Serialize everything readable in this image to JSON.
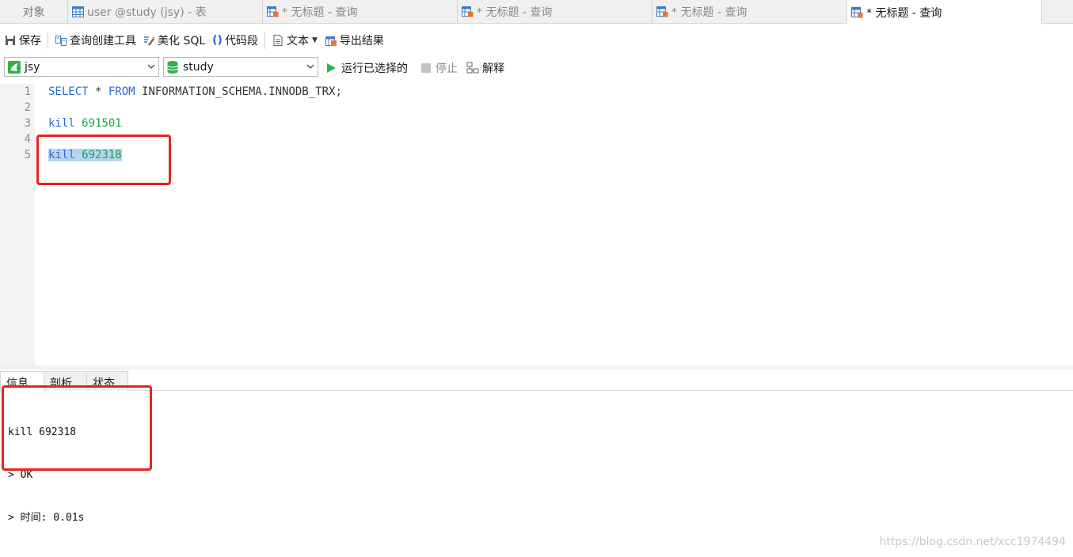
{
  "tabs": [
    {
      "label": "对象",
      "icon": "",
      "active": false
    },
    {
      "label": "user @study (jsy) - 表",
      "icon": "table-icon",
      "active": false
    },
    {
      "label": "* 无标题 - 查询",
      "icon": "query-icon",
      "active": false
    },
    {
      "label": "* 无标题 - 查询",
      "icon": "query-icon",
      "active": false
    },
    {
      "label": "* 无标题 - 查询",
      "icon": "query-icon",
      "active": false
    },
    {
      "label": "* 无标题 - 查询",
      "icon": "query-icon",
      "active": true
    }
  ],
  "toolbar": {
    "save": "保存",
    "query_builder": "查询创建工具",
    "beautify": "美化 SQL",
    "snippet": "代码段",
    "text": "文本",
    "export": "导出结果"
  },
  "connection": {
    "value": "jsy"
  },
  "database": {
    "value": "study"
  },
  "run_actions": {
    "run_selected": "运行已选择的",
    "stop": "停止",
    "explain": "解释"
  },
  "editor": {
    "line_numbers": [
      "1",
      "2",
      "3",
      "4",
      "5"
    ],
    "line1": {
      "kw1": "SELECT",
      "mid": " * ",
      "kw2": "FROM",
      "rest": " INFORMATION_SCHEMA.INNODB_TRX;"
    },
    "line3": {
      "kw": "kill",
      "num": "691501"
    },
    "line5": {
      "kw": "kill",
      "num": "692318"
    }
  },
  "result_tabs": [
    "信息",
    "剖析",
    "状态"
  ],
  "output_lines": [
    "kill 692318",
    "> OK",
    "> 时间: 0.01s"
  ],
  "watermark": "https://blog.csdn.net/xcc1974494",
  "colors": {
    "keyword": "#2a6bd1",
    "number": "#18a84a",
    "highlight_box": "#e8231d",
    "selection": "#b7d3f2",
    "run_icon": "#2db34a"
  }
}
